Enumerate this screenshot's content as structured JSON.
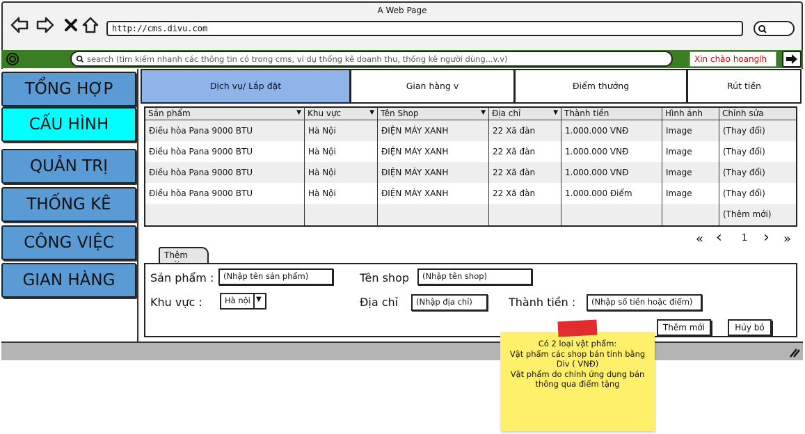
{
  "window": {
    "title": "A Web Page",
    "url": "http://cms.divu.com"
  },
  "topbar": {
    "search_placeholder": "search (tìm kiếm nhanh các thông tin có trong cms, ví dụ thống kê doanh thu, thống kê người dùng...v.v)",
    "greeting": "Xin chào hoanglh"
  },
  "sidebar": {
    "items": [
      {
        "label": "TỔNG HỢP",
        "active": false
      },
      {
        "label": "CẤU HÌNH",
        "active": true
      },
      {
        "label": "QUẢN TRỊ",
        "active": false
      },
      {
        "label": "THỐNG KÊ",
        "active": false
      },
      {
        "label": "CÔNG VIỆC",
        "active": false
      },
      {
        "label": "GIAN HÀNG",
        "active": false
      }
    ]
  },
  "tabs": [
    {
      "label": "Dịch vụ/ Lắp đặt",
      "active": true
    },
    {
      "label": "Gian hàng v",
      "active": false
    },
    {
      "label": "Điểm thưởng",
      "active": false
    },
    {
      "label": "Rút tiền",
      "active": false
    }
  ],
  "table": {
    "columns": [
      "Sản phẩm",
      "Khu vực",
      "Tên Shop",
      "Địa chỉ",
      "Thành tiền",
      "Hình ảnh",
      "Chỉnh sửa"
    ],
    "rows": [
      [
        "Điều hòa Pana 9000 BTU",
        "Hà Nội",
        "ĐIỆN MÁY XANH",
        "22 Xã đàn",
        "1.000.000 VNĐ",
        "Image",
        "(Thay đổi)"
      ],
      [
        "Điều hòa Pana 9000 BTU",
        "Hà Nội",
        "ĐIỆN MÁY XANH",
        "22 Xã đàn",
        "1.000.000 VNĐ",
        "Image",
        "(Thay đổi)"
      ],
      [
        "Điều hòa Pana 9000 BTU",
        "Hà Nội",
        "ĐIỆN MÁY XANH",
        "22 Xã đàn",
        "1.000.000 VNĐ",
        "Image",
        "(Thay đổi)"
      ],
      [
        "Điều hòa Pana 9000 BTU",
        "Hà Nội",
        "ĐIỆN MÁY XANH",
        "22 Xã đàn",
        "1.000.000 Điểm",
        "Image",
        "(Thay đổi)"
      ]
    ],
    "add_new_link": "(Thêm mới)"
  },
  "pager": {
    "first": "«",
    "prev": "‹",
    "page": "1",
    "next": "›",
    "last": "»"
  },
  "form": {
    "tab_label": "Thêm mới",
    "product_label": "Sản phẩm :",
    "product_placeholder": "(Nhập tên sản phẩm)",
    "shop_label": "Tên shop",
    "shop_placeholder": "(Nhập tên shop)",
    "region_label": "Khu vực :",
    "region_value": "Hà nội",
    "address_label": "Địa chỉ",
    "address_placeholder": "(Nhập địa chỉ)",
    "amount_label": "Thành tiền :",
    "amount_placeholder": "(Nhập số tiền hoặc điểm)",
    "submit_label": "Thêm mới",
    "cancel_label": "Hủy bỏ"
  },
  "note": {
    "lines": [
      "Có 2 loại vật phẩm:",
      "Vật phẩm các shop bán tính bằng Div ( VNĐ)",
      "Vật phẩm do chính ứng dụng bán thông qua điểm tặng"
    ]
  },
  "colors": {
    "green_bar": "#3b7d23",
    "sidebar_item": "#5b9bd5",
    "sidebar_active": "#00ffff",
    "tab_active": "#8fb4ea",
    "greeting_text": "#e00000",
    "note_bg": "#fff06b",
    "note_tape": "#e12d2d"
  }
}
